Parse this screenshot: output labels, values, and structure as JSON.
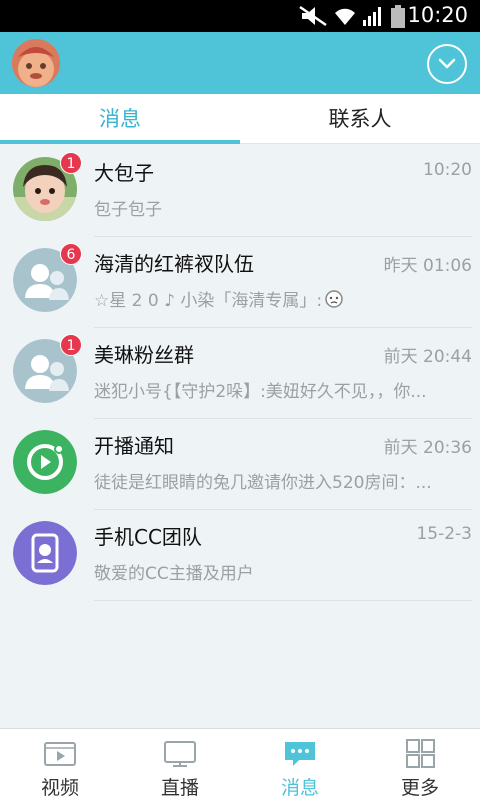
{
  "status_bar": {
    "time": "10:20"
  },
  "tabs": [
    {
      "label": "消息",
      "active": true
    },
    {
      "label": "联系人",
      "active": false
    }
  ],
  "conversations": [
    {
      "name": "大包子",
      "time": "10:20",
      "preview": "包子包子",
      "badge": "1",
      "avatar": "child-photo"
    },
    {
      "name": "海清的红裤衩队伍",
      "time": "昨天 01:06",
      "preview": "☆星 2 0 ♪ 小染「海清专属」:",
      "badge": "6",
      "avatar": "group-icon"
    },
    {
      "name": "美琳粉丝群",
      "time": "前天 20:44",
      "preview": "迷犯小号{【守护2哚】:美妞好久不见，，你...",
      "badge": "1",
      "avatar": "group-icon"
    },
    {
      "name": "开播通知",
      "time": "前天 20:36",
      "preview": "徒徒是红眼睛的兔几邀请你进入520房间：...",
      "badge": "",
      "avatar": "live-play-icon"
    },
    {
      "name": "手机CC团队",
      "time": "15-2-3",
      "preview": "敬爱的CC主播及用户",
      "badge": "",
      "avatar": "cc-team-icon"
    }
  ],
  "bottom_nav": [
    {
      "label": "视频",
      "icon": "video-icon"
    },
    {
      "label": "直播",
      "icon": "tv-icon"
    },
    {
      "label": "消息",
      "icon": "chat-icon",
      "active": true
    },
    {
      "label": "更多",
      "icon": "grid-icon"
    }
  ],
  "colors": {
    "accent": "#4fc3d8",
    "badge": "#e5384f",
    "live_green": "#3cb360",
    "cc_purple": "#7b6fd4"
  }
}
